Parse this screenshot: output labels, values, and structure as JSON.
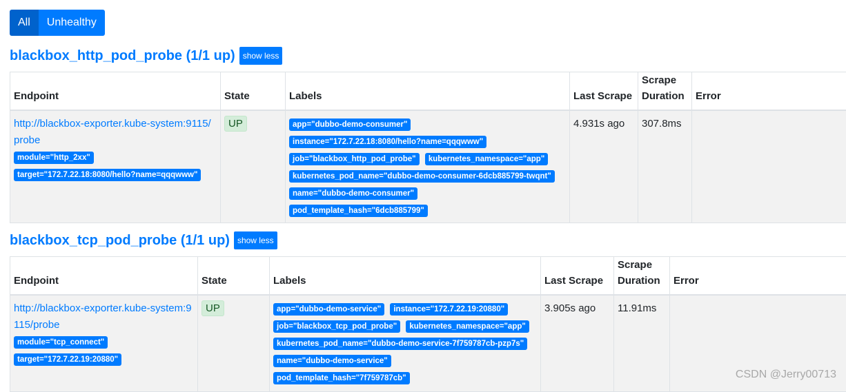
{
  "filters": {
    "all_label": "All",
    "unhealthy_label": "Unhealthy"
  },
  "table_headers": {
    "endpoint": "Endpoint",
    "state": "State",
    "labels": "Labels",
    "last_scrape": "Last Scrape",
    "scrape_duration": "Scrape Duration",
    "error": "Error"
  },
  "pools": [
    {
      "title": "blackbox_http_pod_probe (1/1 up)",
      "toggle_label": "show less",
      "target": {
        "endpoint_url": "http://blackbox-exporter.kube-system:9115/probe",
        "endpoint_params": [
          "module=\"http_2xx\"",
          "target=\"172.7.22.18:8080/hello?name=qqqwww\""
        ],
        "state": "UP",
        "labels": [
          "app=\"dubbo-demo-consumer\"",
          "instance=\"172.7.22.18:8080/hello?name=qqqwww\"",
          "job=\"blackbox_http_pod_probe\"",
          "kubernetes_namespace=\"app\"",
          "kubernetes_pod_name=\"dubbo-demo-consumer-6dcb885799-twqnt\"",
          "name=\"dubbo-demo-consumer\"",
          "pod_template_hash=\"6dcb885799\""
        ],
        "last_scrape": "4.931s ago",
        "scrape_duration": "307.8ms",
        "error": ""
      }
    },
    {
      "title": "blackbox_tcp_pod_probe (1/1 up)",
      "toggle_label": "show less",
      "target": {
        "endpoint_url": "http://blackbox-exporter.kube-system:9115/probe",
        "endpoint_params": [
          "module=\"tcp_connect\"",
          "target=\"172.7.22.19:20880\""
        ],
        "state": "UP",
        "labels": [
          "app=\"dubbo-demo-service\"",
          "instance=\"172.7.22.19:20880\"",
          "job=\"blackbox_tcp_pod_probe\"",
          "kubernetes_namespace=\"app\"",
          "kubernetes_pod_name=\"dubbo-demo-service-7f759787cb-pzp7s\"",
          "name=\"dubbo-demo-service\"",
          "pod_template_hash=\"7f759787cb\""
        ],
        "last_scrape": "3.905s ago",
        "scrape_duration": "11.91ms",
        "error": ""
      }
    }
  ],
  "watermark": "CSDN @Jerry00713",
  "colors": {
    "primary": "#007bff",
    "primary_active": "#0062cc",
    "up_bg": "#d4edda",
    "up_text": "#155724"
  }
}
